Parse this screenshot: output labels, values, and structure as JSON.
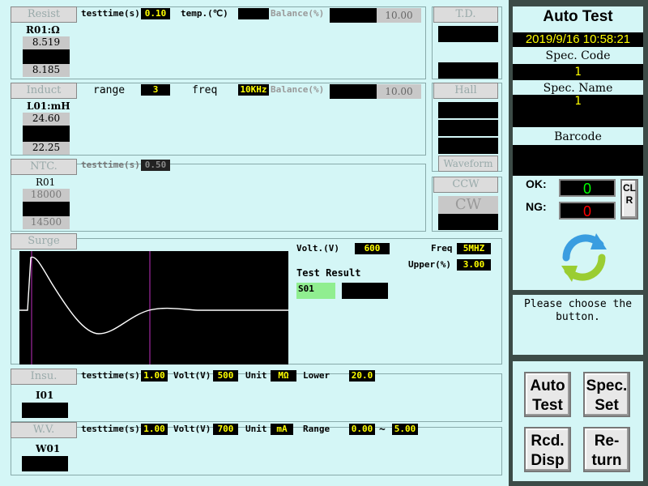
{
  "resist": {
    "tab": "Resist",
    "testtime_label": "testtime(s)",
    "testtime": "0.10",
    "temp_label": "temp.(℃)",
    "balance_label": "Balance(%)",
    "balance": "10.00",
    "r_label": "R01:Ω",
    "upper": "8.519",
    "lower": "8.185"
  },
  "td": {
    "tab": "T.D."
  },
  "induct": {
    "tab": "Induct",
    "range_label": "range",
    "range": "3",
    "freq_label": "freq",
    "freq": "10KHz",
    "balance_label": "Balance(%)",
    "balance": "10.00",
    "l_label": "L01:mH",
    "upper": "24.60",
    "lower": "22.25"
  },
  "hall": {
    "tab": "Hall",
    "waveform": "Waveform"
  },
  "ntc": {
    "tab": "NTC.",
    "testtime_label": "testtime(s)",
    "testtime": "0.50",
    "r_label": "R01",
    "upper": "18000",
    "lower": "14500"
  },
  "ccw": {
    "tab": "CCW",
    "cw": "CW"
  },
  "surge": {
    "tab": "Surge",
    "volt_label": "Volt.(V)",
    "volt": "600",
    "freq_label": "Freq",
    "freq": "5MHZ",
    "upper_label": "Upper(%)",
    "upper": "3.00",
    "result_label": "Test Result",
    "result_id": "S01"
  },
  "insu": {
    "tab": "Insu.",
    "testtime_label": "testtime(s)",
    "testtime": "1.00",
    "volt_label": "Volt(V)",
    "volt": "500",
    "unit_label": "Unit",
    "unit": "MΩ",
    "lower_label": "Lower",
    "lower": "20.0",
    "item": "I01"
  },
  "wv": {
    "tab": "W.V.",
    "testtime_label": "testtime(s)",
    "testtime": "1.00",
    "volt_label": "Volt(V)",
    "volt": "700",
    "unit_label": "Unit",
    "unit": "mA",
    "range_label": "Range",
    "range_lo": "0.00",
    "tilde": "~",
    "range_hi": "5.00",
    "item": "W01"
  },
  "side": {
    "title": "Auto Test",
    "datetime": "2019/9/16 10:58:21",
    "spec_code_label": "Spec. Code",
    "spec_code": "1",
    "spec_name_label": "Spec. Name",
    "spec_name": "1",
    "barcode_label": "Barcode",
    "ok_label": "OK:",
    "ok": "0",
    "ng_label": "NG:",
    "ng": "0",
    "clr": "CLR",
    "message": "Please choose the button.",
    "btn_auto": "Auto Test",
    "btn_spec": "Spec. Set",
    "btn_rcd": "Rcd. Disp",
    "btn_return": "Re- turn"
  },
  "colors": {
    "bg": "#d4f6f6",
    "ok": "#00ff00",
    "ng": "#ff0000",
    "yellow": "#ffff00"
  }
}
